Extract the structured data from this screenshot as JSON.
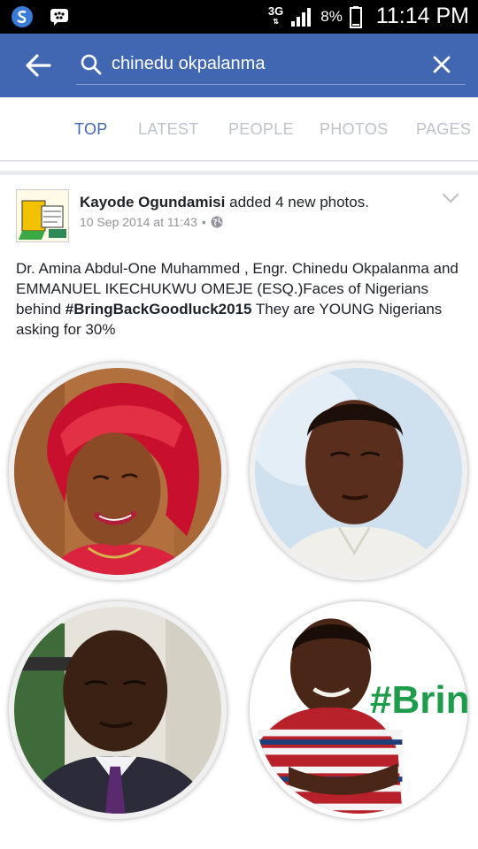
{
  "status_bar": {
    "network": "3G",
    "battery": "8%",
    "time": "11:14 PM"
  },
  "search": {
    "query": "chinedu okpalanma"
  },
  "tabs": [
    {
      "label": "TOP",
      "active": true
    },
    {
      "label": "LATEST",
      "active": false
    },
    {
      "label": "PEOPLE",
      "active": false
    },
    {
      "label": "PHOTOS",
      "active": false
    },
    {
      "label": "PAGES",
      "active": false
    }
  ],
  "post": {
    "author": "Kayode Ogundamisi",
    "action": "added 4 new photos.",
    "timestamp": "10 Sep 2014 at 11:43",
    "separator": "•",
    "text_before": "Dr. Amina Abdul-One Muhammed , Engr. Chinedu Okpalanma and EMMANUEL IKECHUKWU OMEJE (ESQ.)Faces of Nigerians behind ",
    "hashtag": "#BringBackGoodluck2015",
    "text_after": " They are YOUNG Nigerians asking for 30%",
    "photo_banner": "#Brin"
  },
  "colors": {
    "brand_blue": "#4267b2",
    "tab_inactive": "#bec3c9",
    "hashtag_green": "#1f9c4a"
  }
}
